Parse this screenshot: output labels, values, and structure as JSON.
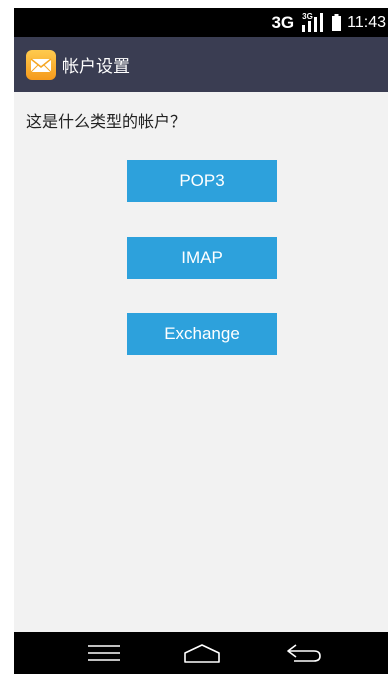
{
  "status_bar": {
    "network_type": "3G",
    "signal_label": "3G",
    "time": "11:43",
    "icons": [
      "signal-icon",
      "battery-icon"
    ]
  },
  "action_bar": {
    "icon": "mail-icon",
    "title": "帐户设置",
    "background_color": "#3a3d52"
  },
  "content": {
    "question": "这是什么类型的帐户？",
    "buttons": [
      {
        "label": "POP3"
      },
      {
        "label": "IMAP"
      },
      {
        "label": "Exchange"
      }
    ],
    "button_color": "#2da1dc"
  },
  "nav_bar": {
    "icons": [
      "menu-icon",
      "home-icon",
      "back-icon"
    ]
  }
}
